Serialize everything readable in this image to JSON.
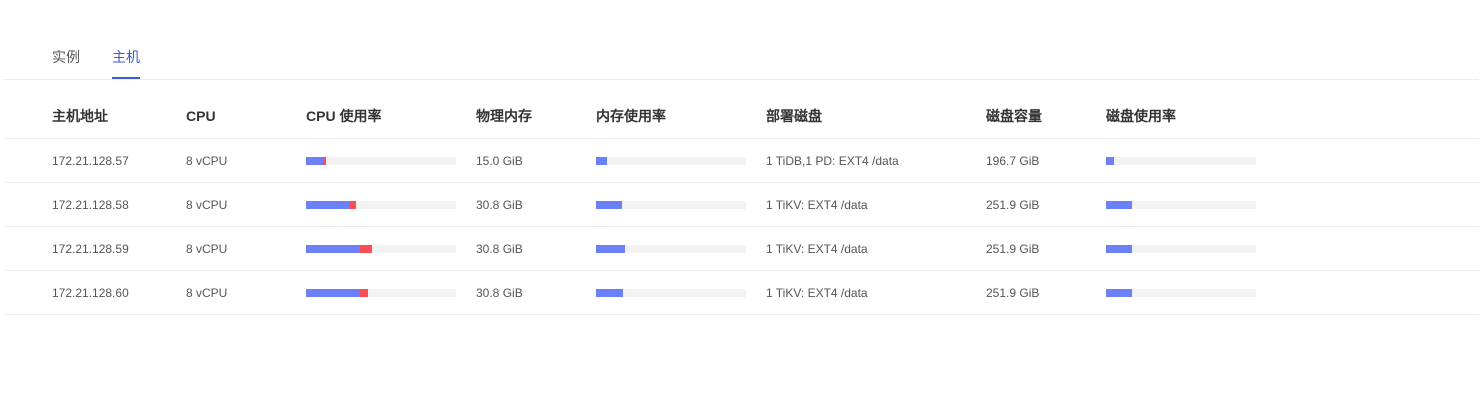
{
  "tabs": [
    {
      "label": "实例",
      "active": false
    },
    {
      "label": "主机",
      "active": true
    }
  ],
  "columns": {
    "host": "主机地址",
    "cpu": "CPU",
    "cpu_usage": "CPU 使用率",
    "memory": "物理内存",
    "memory_usage": "内存使用率",
    "deploy_disk": "部署磁盘",
    "disk_capacity": "磁盘容量",
    "disk_usage": "磁盘使用率"
  },
  "colors": {
    "accent": "#3c5bd6",
    "usage_blue": "#6b7ff8",
    "usage_red": "#fb4d56",
    "track": "#f2f2f2"
  },
  "rows": [
    {
      "host": "172.21.128.57",
      "cpu": "8 vCPU",
      "cpu_usage": {
        "user": 0.11,
        "system": 0.02
      },
      "memory": "15.0 GiB",
      "memory_usage": 0.07,
      "deploy_disk": "1 TiDB,1 PD: EXT4 /data",
      "disk_capacity": "196.7 GiB",
      "disk_usage": 0.05
    },
    {
      "host": "172.21.128.58",
      "cpu": "8 vCPU",
      "cpu_usage": {
        "user": 0.29,
        "system": 0.04
      },
      "memory": "30.8 GiB",
      "memory_usage": 0.17,
      "deploy_disk": "1 TiKV: EXT4 /data",
      "disk_capacity": "251.9 GiB",
      "disk_usage": 0.17
    },
    {
      "host": "172.21.128.59",
      "cpu": "8 vCPU",
      "cpu_usage": {
        "user": 0.36,
        "system": 0.08
      },
      "memory": "30.8 GiB",
      "memory_usage": 0.19,
      "deploy_disk": "1 TiKV: EXT4 /data",
      "disk_capacity": "251.9 GiB",
      "disk_usage": 0.17
    },
    {
      "host": "172.21.128.60",
      "cpu": "8 vCPU",
      "cpu_usage": {
        "user": 0.36,
        "system": 0.05
      },
      "memory": "30.8 GiB",
      "memory_usage": 0.18,
      "deploy_disk": "1 TiKV: EXT4 /data",
      "disk_capacity": "251.9 GiB",
      "disk_usage": 0.17
    }
  ]
}
